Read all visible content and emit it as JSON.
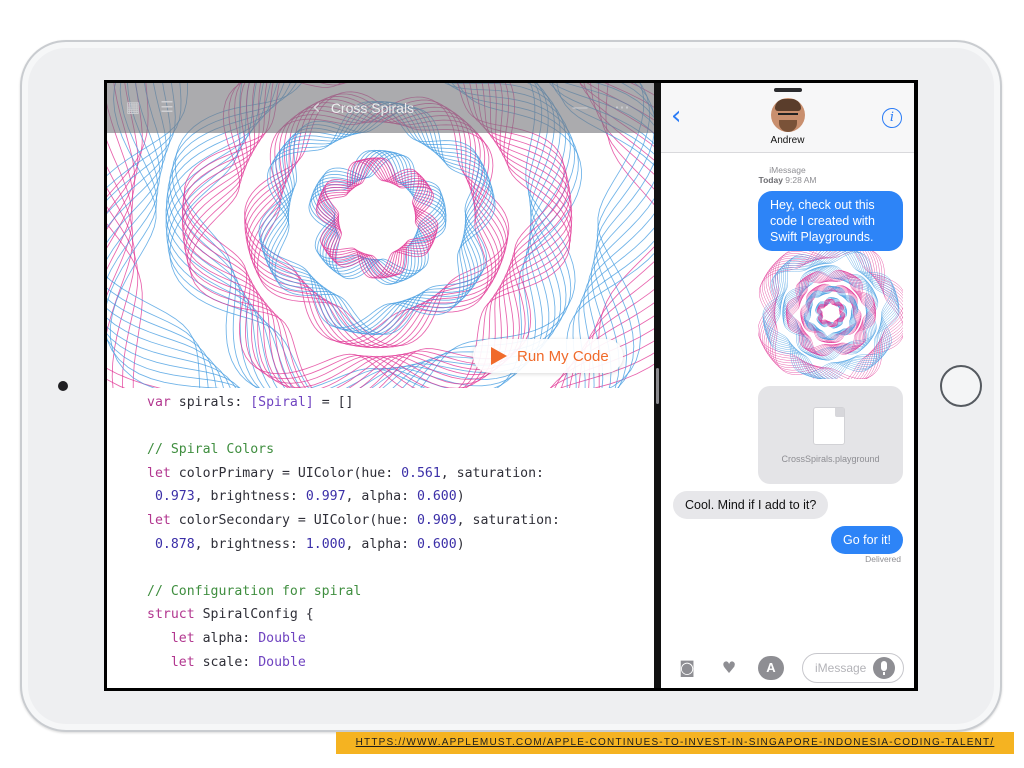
{
  "colors": {
    "spiral_primary": "#3f9ae0",
    "spiral_secondary": "#e02f92",
    "accent_orange": "#f06a2a",
    "imessage_blue": "#2d84f7",
    "banner_yellow": "#f5b321"
  },
  "playground": {
    "title": "Cross Spirals",
    "toolbar_icons": [
      "grid-icon",
      "list-icon",
      "back-chevron-icon",
      "add-icon",
      "more-icon"
    ],
    "run_button_label": "Run My Code",
    "code_lines": [
      {
        "segments": [
          {
            "t": "var",
            "c": "kw"
          },
          {
            "t": " spirals: ",
            "c": ""
          },
          {
            "t": "[Spiral]",
            "c": "ty"
          },
          {
            "t": " = []",
            "c": ""
          }
        ]
      },
      {
        "segments": []
      },
      {
        "segments": [
          {
            "t": "// Spiral Colors",
            "c": "cm"
          }
        ]
      },
      {
        "segments": [
          {
            "t": "let",
            "c": "kw"
          },
          {
            "t": " colorPrimary = UIColor(hue: ",
            "c": ""
          },
          {
            "t": "0.561",
            "c": "nu"
          },
          {
            "t": ", saturation:",
            "c": ""
          }
        ]
      },
      {
        "segments": [
          {
            "t": " ",
            "c": ""
          },
          {
            "t": "0.973",
            "c": "nu"
          },
          {
            "t": ", brightness: ",
            "c": ""
          },
          {
            "t": "0.997",
            "c": "nu"
          },
          {
            "t": ", alpha: ",
            "c": ""
          },
          {
            "t": "0.600",
            "c": "nu"
          },
          {
            "t": ")",
            "c": ""
          }
        ]
      },
      {
        "segments": [
          {
            "t": "let",
            "c": "kw"
          },
          {
            "t": " colorSecondary = UIColor(hue: ",
            "c": ""
          },
          {
            "t": "0.909",
            "c": "nu"
          },
          {
            "t": ", saturation:",
            "c": ""
          }
        ]
      },
      {
        "segments": [
          {
            "t": " ",
            "c": ""
          },
          {
            "t": "0.878",
            "c": "nu"
          },
          {
            "t": ", brightness: ",
            "c": ""
          },
          {
            "t": "1.000",
            "c": "nu"
          },
          {
            "t": ", alpha: ",
            "c": ""
          },
          {
            "t": "0.600",
            "c": "nu"
          },
          {
            "t": ")",
            "c": ""
          }
        ]
      },
      {
        "segments": []
      },
      {
        "segments": [
          {
            "t": "// Configuration for spiral",
            "c": "cm"
          }
        ]
      },
      {
        "segments": [
          {
            "t": "struct",
            "c": "kw"
          },
          {
            "t": " SpiralConfig {",
            "c": ""
          }
        ]
      },
      {
        "segments": [
          {
            "t": "   ",
            "c": ""
          },
          {
            "t": "let",
            "c": "kw"
          },
          {
            "t": " alpha: ",
            "c": ""
          },
          {
            "t": "Double",
            "c": "ty"
          }
        ]
      },
      {
        "segments": [
          {
            "t": "   ",
            "c": ""
          },
          {
            "t": "let",
            "c": "kw"
          },
          {
            "t": " scale: ",
            "c": ""
          },
          {
            "t": "Double",
            "c": "ty"
          }
        ]
      }
    ]
  },
  "messages": {
    "contact_name": "Andrew",
    "service": "iMessage",
    "time_day": "Today",
    "time_clock": "9:28 AM",
    "outgoing_1": "Hey, check out this code I created with Swift Playgrounds.",
    "attachment_filename": "CrossSpirals.playground",
    "incoming_1": "Cool. Mind if I add to it?",
    "outgoing_2": "Go for it!",
    "status": "Delivered",
    "input_placeholder": "iMessage"
  },
  "banner": {
    "url": "HTTPS://WWW.APPLEMUST.COM/APPLE-CONTINUES-TO-INVEST-IN-SINGAPORE-INDONESIA-CODING-TALENT/"
  }
}
